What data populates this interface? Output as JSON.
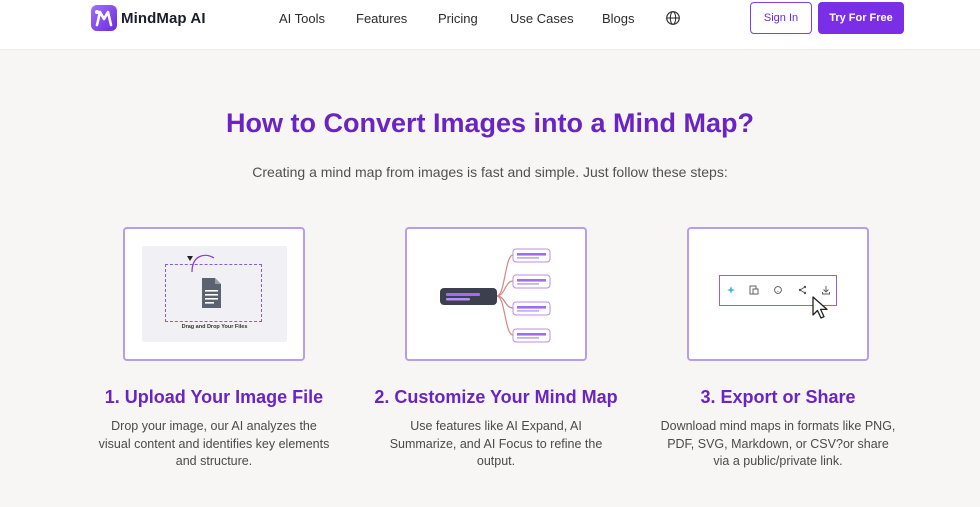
{
  "header": {
    "brand": "MindMap AI",
    "nav": [
      "AI Tools",
      "Features",
      "Pricing",
      "Use Cases",
      "Blogs"
    ],
    "sign_in": "Sign In",
    "try_free": "Try For Free"
  },
  "main": {
    "title": "How to Convert Images into a Mind Map?",
    "subtitle": "Creating a mind map from images is fast and simple. Just follow these steps:",
    "steps": [
      {
        "title": "1. Upload Your Image File",
        "description": "Drop your image, our AI analyzes the visual content and identifies key elements and structure.",
        "caption": "Drag and Drop Your Files"
      },
      {
        "title": "2. Customize Your Mind Map",
        "description": "Use features like AI Expand, AI Summarize, and AI Focus to refine the output."
      },
      {
        "title": "3. Export or Share",
        "description": "Download mind maps in formats like PNG, PDF, SVG, Markdown, or CSV?or share via a public/private link."
      }
    ]
  },
  "colors": {
    "accent": "#7a2ee6",
    "heading": "#6a24c4",
    "card_border": "#b79cf0"
  }
}
